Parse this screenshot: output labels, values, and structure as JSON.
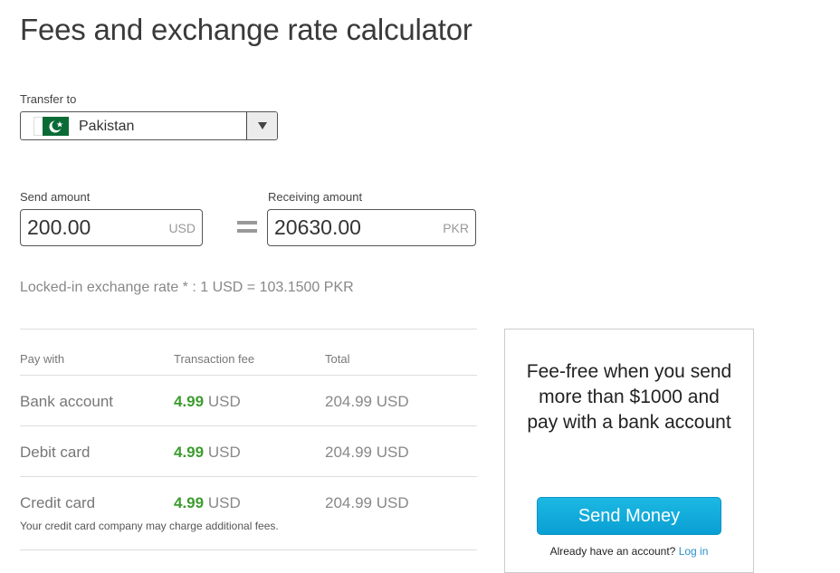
{
  "page": {
    "title": "Fees and exchange rate calculator"
  },
  "transfer": {
    "label": "Transfer to",
    "country": "Pakistan",
    "flag_icon": "pakistan-flag-icon"
  },
  "send": {
    "label": "Send amount",
    "value": "200.00",
    "currency": "USD"
  },
  "receive": {
    "label": "Receiving amount",
    "value": "20630.00",
    "currency": "PKR"
  },
  "rate": {
    "text": "Locked-in exchange rate * : 1 USD = 103.1500 PKR"
  },
  "table": {
    "headers": [
      "Pay with",
      "Transaction fee",
      "Total"
    ],
    "rows": [
      {
        "method": "Bank account",
        "fee": "4.99",
        "fee_currency": "USD",
        "total": "204.99 USD"
      },
      {
        "method": "Debit card",
        "fee": "4.99",
        "fee_currency": "USD",
        "total": "204.99 USD"
      },
      {
        "method": "Credit card",
        "fee": "4.99",
        "fee_currency": "USD",
        "total": "204.99 USD",
        "note": "Your credit card company may charge additional fees."
      }
    ]
  },
  "promo": {
    "text": "Fee-free when you send more than $1000 and pay with a bank account",
    "button_label": "Send Money",
    "login_prompt": "Already have an account?",
    "login_link": "Log in"
  },
  "colors": {
    "fee_green": "#3c9c2e",
    "button_blue": "#12abdc",
    "link_blue": "#2a8fc7"
  }
}
